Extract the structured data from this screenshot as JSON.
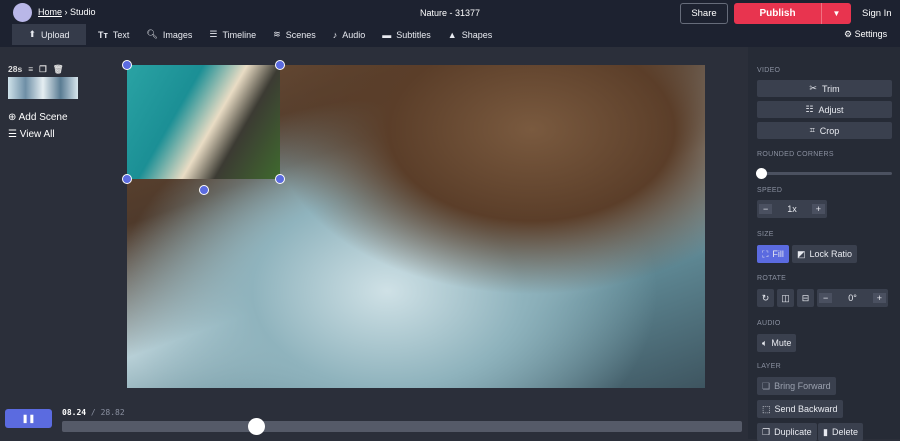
{
  "header": {
    "home": "Home",
    "separator": "›",
    "studio": "Studio",
    "project_title": "Nature - 31377",
    "share": "Share",
    "publish": "Publish",
    "sign_in": "Sign In",
    "settings": "Settings"
  },
  "menu": [
    {
      "label": "Upload",
      "icon": "⬆"
    },
    {
      "label": "Text",
      "icon": "Tт"
    },
    {
      "label": "Images",
      "icon": "🔍︎"
    },
    {
      "label": "Timeline",
      "icon": "☰"
    },
    {
      "label": "Scenes",
      "icon": "≋"
    },
    {
      "label": "Audio",
      "icon": "♪"
    },
    {
      "label": "Subtitles",
      "icon": "▬"
    },
    {
      "label": "Shapes",
      "icon": "▲"
    }
  ],
  "scenes": {
    "duration": "28s",
    "add_scene": "Add Scene",
    "view_all": "View All"
  },
  "panel": {
    "video_label": "VIDEO",
    "trim": "Trim",
    "adjust": "Adjust",
    "crop": "Crop",
    "rounded_label": "ROUNDED CORNERS",
    "rounded_value": 0,
    "speed_label": "SPEED",
    "speed_value": "1x",
    "size_label": "SIZE",
    "fill": "Fill",
    "lock_ratio": "Lock Ratio",
    "rotate_label": "ROTATE",
    "rotate_value": "0°",
    "audio_label": "AUDIO",
    "mute": "Mute",
    "layer_label": "LAYER",
    "bring_forward": "Bring Forward",
    "send_backward": "Send Backward",
    "duplicate": "Duplicate",
    "delete": "Delete"
  },
  "playback": {
    "current": "08.24",
    "separator": "/",
    "total": "28.82",
    "progress": 0.286
  },
  "colors": {
    "accent": "#5b6be0",
    "publish": "#e8344f"
  }
}
